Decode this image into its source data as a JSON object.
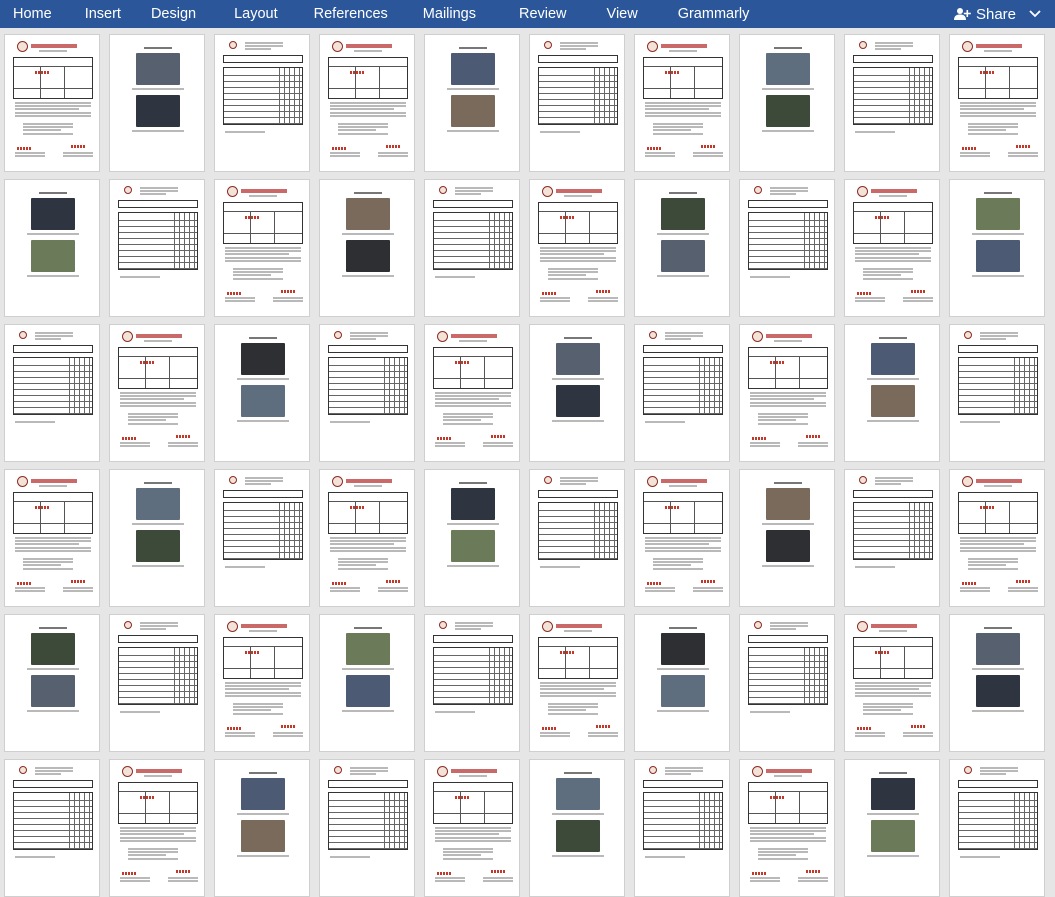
{
  "ribbon": {
    "tabs": [
      "Home",
      "Insert",
      "Design",
      "Layout",
      "References",
      "Mailings",
      "Review",
      "View",
      "Grammarly"
    ],
    "share_label": "Share"
  },
  "colors": {
    "ribbon_bg": "#2b579a",
    "workspace_bg": "#e6e6e6",
    "page_bg": "#ffffff",
    "brand_red": "#c0504d"
  },
  "icons": [
    "add-person-icon",
    "chevron-down-icon"
  ],
  "thumbnails": {
    "page_types": [
      "report",
      "photos",
      "table",
      "report",
      "photos",
      "table",
      "report",
      "photos",
      "table",
      "report",
      "photos",
      "table",
      "report",
      "photos",
      "table",
      "report",
      "photos",
      "table",
      "report",
      "photos",
      "table",
      "report",
      "photos",
      "table",
      "report",
      "photos",
      "table",
      "report",
      "photos",
      "table",
      "report",
      "photos",
      "table",
      "report",
      "photos",
      "table",
      "report",
      "photos",
      "table",
      "report",
      "photos",
      "table",
      "report",
      "photos",
      "table",
      "report",
      "photos",
      "table",
      "report",
      "photos",
      "table",
      "report",
      "photos",
      "table",
      "report",
      "photos",
      "table",
      "report",
      "photos",
      "table"
    ]
  }
}
